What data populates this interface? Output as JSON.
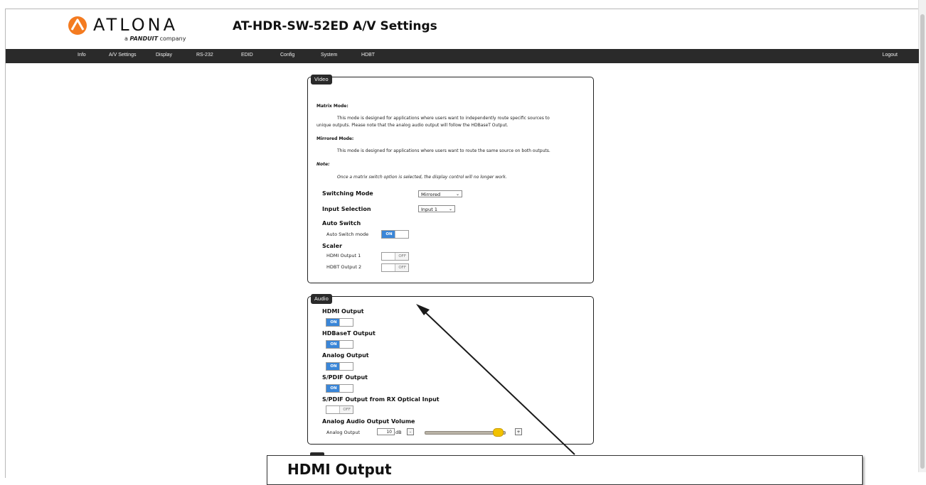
{
  "header": {
    "brand": "ATLONA",
    "tagline_prefix": "a",
    "tagline_brand": "PANDUIT",
    "tagline_suffix": "company",
    "page_title": "AT-HDR-SW-52ED  A/V Settings"
  },
  "nav": {
    "items": [
      "Info",
      "A/V Settings",
      "Display",
      "RS-232",
      "EDID",
      "Config",
      "System",
      "HDBT"
    ],
    "logout": "Logout"
  },
  "video": {
    "panel_title": "Video",
    "matrix_heading": "Matrix Mode:",
    "matrix_text_1": "This mode is designed for applications where users want to independently route specific sources to",
    "matrix_text_2": "unique outputs. Please note that the analog audio output will follow the HDBaseT Output.",
    "mirrored_heading": "Mirrored Mode:",
    "mirrored_text": "This mode is designed for applications where users want to route the same source on both outputs.",
    "note_heading": "Note:",
    "note_text": "Once a matrix switch option is selected, the display control will no longer work.",
    "switching_mode_label": "Switching Mode",
    "switching_mode_value": "Mirrored",
    "input_selection_label": "Input Selection",
    "input_selection_value": "Input 1",
    "auto_switch_label": "Auto Switch",
    "auto_switch_mode_label": "Auto Switch mode",
    "scaler_label": "Scaler",
    "hdmi_output_1_label": "HDMI Output 1",
    "hdbt_output_2_label": "HDBT Output 2",
    "on_text": "ON",
    "off_text": "OFF"
  },
  "audio": {
    "panel_title": "Audio",
    "hdmi_output_label": "HDMI Output",
    "hdbaset_output_label": "HDBaseT Output",
    "analog_output_label": "Analog Output",
    "spdif_output_label": "S/PDIF Output",
    "spdif_rx_label": "S/PDIF Output from RX Optical Input",
    "volume_heading": "Analog Audio Output Volume",
    "analog_output_sub": "Analog Output",
    "volume_value": "10",
    "volume_unit": "dB",
    "minus": "-",
    "plus": "+",
    "on_text": "ON",
    "off_text": "OFF"
  },
  "zoom": {
    "text": "HDMI Output"
  }
}
